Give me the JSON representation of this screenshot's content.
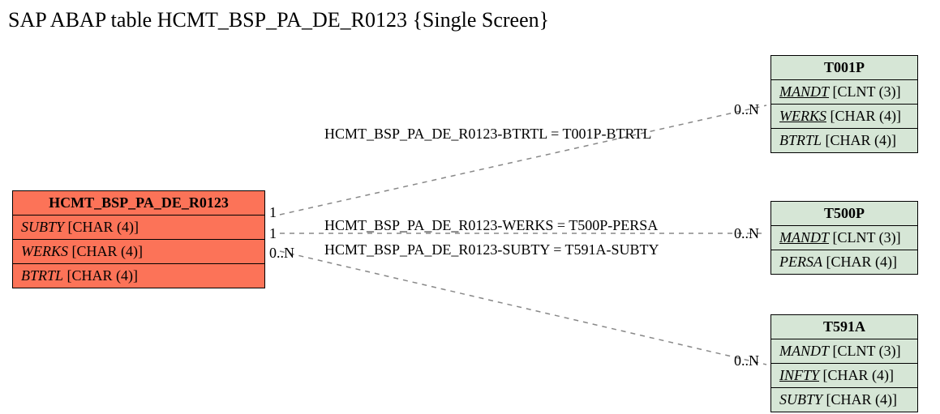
{
  "title": "SAP ABAP table HCMT_BSP_PA_DE_R0123 {Single Screen}",
  "main_entity": {
    "name": "HCMT_BSP_PA_DE_R0123",
    "fields": [
      {
        "name": "SUBTY",
        "type": "[CHAR (4)]",
        "underline": false
      },
      {
        "name": "WERKS",
        "type": "[CHAR (4)]",
        "underline": false
      },
      {
        "name": "BTRTL",
        "type": "[CHAR (4)]",
        "underline": false
      }
    ]
  },
  "related": [
    {
      "name": "T001P",
      "fields": [
        {
          "name": "MANDT",
          "type": "[CLNT (3)]",
          "underline": true
        },
        {
          "name": "WERKS",
          "type": "[CHAR (4)]",
          "underline": true
        },
        {
          "name": "BTRTL",
          "type": "[CHAR (4)]",
          "underline": false
        }
      ]
    },
    {
      "name": "T500P",
      "fields": [
        {
          "name": "MANDT",
          "type": "[CLNT (3)]",
          "underline": true
        },
        {
          "name": "PERSA",
          "type": "[CHAR (4)]",
          "underline": false
        }
      ]
    },
    {
      "name": "T591A",
      "fields": [
        {
          "name": "MANDT",
          "type": "[CLNT (3)]",
          "underline": false
        },
        {
          "name": "INFTY",
          "type": "[CHAR (4)]",
          "underline": true
        },
        {
          "name": "SUBTY",
          "type": "[CHAR (4)]",
          "underline": false
        }
      ]
    }
  ],
  "relations": [
    {
      "label": "HCMT_BSP_PA_DE_R0123-BTRTL = T001P-BTRTL",
      "card_left": "1",
      "card_right": "0..N"
    },
    {
      "label": "HCMT_BSP_PA_DE_R0123-WERKS = T500P-PERSA",
      "card_left": "1",
      "card_right": "0..N"
    },
    {
      "label": "HCMT_BSP_PA_DE_R0123-SUBTY = T591A-SUBTY",
      "card_left": "0..N",
      "card_right": "0..N"
    }
  ]
}
